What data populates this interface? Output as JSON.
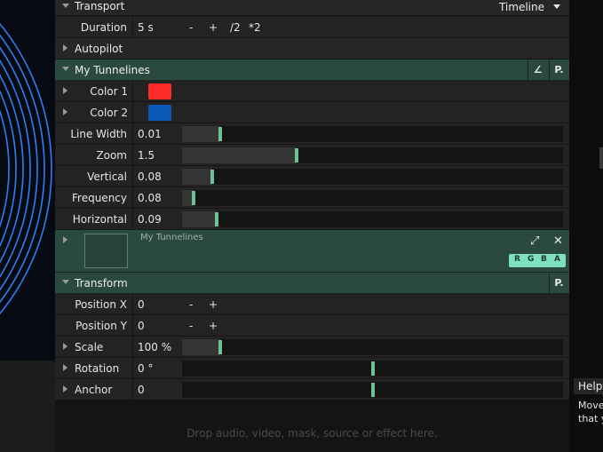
{
  "transport": {
    "title": "Transport",
    "timeline_label": "Timeline"
  },
  "duration": {
    "label": "Duration",
    "value": "5 s",
    "minus": "-",
    "plus": "+",
    "half": "/2",
    "double": "*2"
  },
  "autopilot": {
    "title": "Autopilot"
  },
  "tunnelines": {
    "title": "My Tunnelines",
    "icon_a": "∠",
    "icon_b": "P.",
    "color1": {
      "label": "Color 1",
      "color": "#ff2a2a"
    },
    "color2": {
      "label": "Color 2",
      "color": "#0a58b5"
    },
    "params": [
      {
        "label": "Line Width",
        "value": "0.01",
        "level": 0.1
      },
      {
        "label": "Zoom",
        "value": "1.5",
        "level": 0.3
      },
      {
        "label": "Vertical",
        "value": "0.08",
        "level": 0.08
      },
      {
        "label": "Frequency",
        "value": "0.08",
        "level": 0.03
      },
      {
        "label": "Horizontal",
        "value": "0.09",
        "level": 0.09
      }
    ]
  },
  "layer": {
    "name": "My Tunnelines",
    "expand_icon": "⤢",
    "close_icon": "✕",
    "channels": [
      "R",
      "G",
      "B",
      "A"
    ]
  },
  "transform": {
    "title": "Transform",
    "icon": "P.",
    "position_x": {
      "label": "Position X",
      "value": "0",
      "minus": "-",
      "plus": "+"
    },
    "position_y": {
      "label": "Position Y",
      "value": "0",
      "minus": "-",
      "plus": "+"
    },
    "scale": {
      "label": "Scale",
      "value": "100 %",
      "level": 0.1
    },
    "rotation": {
      "label": "Rotation",
      "value": "0 °",
      "level": 0.5
    },
    "anchor": {
      "label": "Anchor",
      "value": "0",
      "level": 0.5
    }
  },
  "drop_hint": "Drop audio, video, mask, source or effect here.",
  "help": {
    "tab": "Help",
    "line1": "Move",
    "line2": "that y"
  },
  "colors": {
    "accent": "#6fbf98",
    "header_green": "#2b4a3e",
    "channel_badge": "#7fe0bd"
  }
}
